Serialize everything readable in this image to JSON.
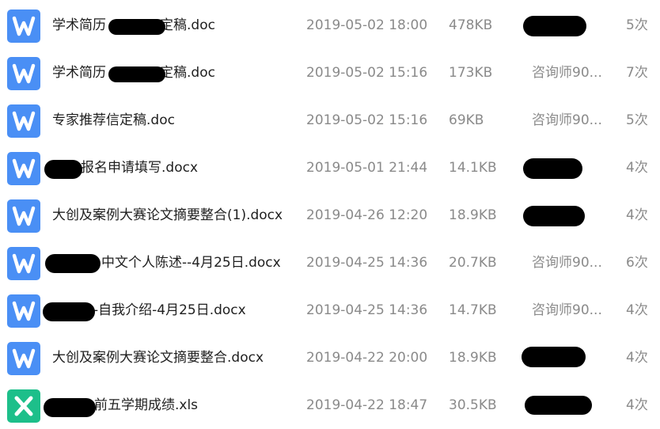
{
  "colors": {
    "word_icon": "#4a8ff5",
    "excel_icon": "#1dbf8a",
    "name_text": "#1f1f1f",
    "meta_text": "#8a8a8a",
    "redaction": "#000000"
  },
  "files": [
    {
      "icon": "word-icon",
      "name_pre": "学术简历",
      "name_post": "定稿.doc",
      "date": "2019-05-02 18:00",
      "size": "478KB",
      "sender": "",
      "count": "5次"
    },
    {
      "icon": "word-icon",
      "name_pre": "学术简历",
      "name_post": "定稿.doc",
      "date": "2019-05-02 15:16",
      "size": "173KB",
      "sender": "咨询师90...",
      "count": "7次"
    },
    {
      "icon": "word-icon",
      "name_pre": "专家推荐信定稿.doc",
      "name_post": "",
      "date": "2019-05-02 15:16",
      "size": "69KB",
      "sender": "咨询师90...",
      "count": "5次"
    },
    {
      "icon": "word-icon",
      "name_pre": "",
      "name_post": "报名申请填写.docx",
      "date": "2019-05-01 21:44",
      "size": "14.1KB",
      "sender": "",
      "count": "4次"
    },
    {
      "icon": "word-icon",
      "name_pre": "大创及案例大赛论文摘要整合(1).docx",
      "name_post": "",
      "date": "2019-04-26 12:20",
      "size": "18.9KB",
      "sender": "",
      "count": "4次"
    },
    {
      "icon": "word-icon",
      "name_pre": "",
      "name_post": "中文个人陈述--4月25日.docx",
      "date": "2019-04-25 14:36",
      "size": "20.7KB",
      "sender": "咨询师90...",
      "count": "6次"
    },
    {
      "icon": "word-icon",
      "name_pre": "",
      "name_post": "-自我介绍-4月25日.docx",
      "date": "2019-04-25 14:36",
      "size": "14.7KB",
      "sender": "咨询师90...",
      "count": "4次"
    },
    {
      "icon": "word-icon",
      "name_pre": "大创及案例大赛论文摘要整合.docx",
      "name_post": "",
      "date": "2019-04-22 20:00",
      "size": "18.9KB",
      "sender": "",
      "count": "4次"
    },
    {
      "icon": "excel-icon",
      "name_pre": "",
      "name_post": "前五学期成绩.xls",
      "date": "2019-04-22 18:47",
      "size": "30.5KB",
      "sender": "",
      "count": "4次"
    }
  ]
}
